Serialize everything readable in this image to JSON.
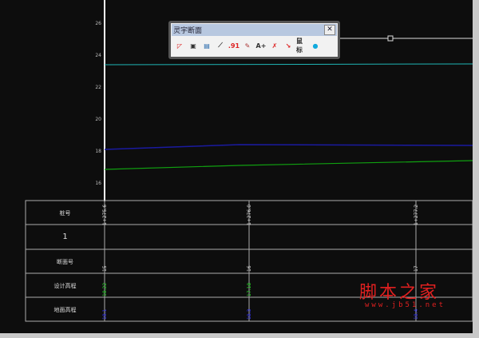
{
  "toolbar": {
    "title": "灵宇断面",
    "close": "✕",
    "icons": [
      {
        "name": "profile-icon",
        "glyph": "◸",
        "color": "#d22"
      },
      {
        "name": "frame-icon",
        "glyph": "▣",
        "color": "#333"
      },
      {
        "name": "chart-icon",
        "glyph": "▤",
        "color": "#26a"
      },
      {
        "name": "ruler-icon",
        "glyph": "⟋",
        "color": "#333"
      },
      {
        "name": "number-icon",
        "glyph": ".91",
        "color": "#d22"
      },
      {
        "name": "pen-icon",
        "glyph": "✎",
        "color": "#a33"
      },
      {
        "name": "elevation-icon",
        "glyph": "A+",
        "color": "#333"
      },
      {
        "name": "delete-line-icon",
        "glyph": "✗",
        "color": "#d22"
      },
      {
        "name": "edit-line-icon",
        "glyph": "↘",
        "color": "#d22"
      },
      {
        "name": "label-icon",
        "glyph": "鼠标",
        "color": "#333"
      },
      {
        "name": "color-icon",
        "glyph": "●",
        "color": "#1ad"
      }
    ]
  },
  "axis": {
    "ticks": [
      "26",
      "24",
      "22",
      "20",
      "18",
      "16"
    ]
  },
  "table": {
    "rows": [
      "桩号",
      "1",
      "断面号",
      "设计高程",
      "地面高程"
    ],
    "columns": [
      {
        "station": "1+275.6",
        "section": "15",
        "design": "18.22",
        "ground": "18.1"
      },
      {
        "station": "1+276.0",
        "section": "16",
        "design": "17.18",
        "ground": "18.3"
      },
      {
        "station": "1+277.2",
        "section": "17",
        "design": "",
        "ground": "18.4"
      }
    ]
  },
  "colors": {
    "cyan": "#1fb5b5",
    "blue": "#1a1aa0",
    "green": "#10a010"
  },
  "watermark": {
    "title": "脚本之家",
    "url": "www.jb51.net"
  }
}
